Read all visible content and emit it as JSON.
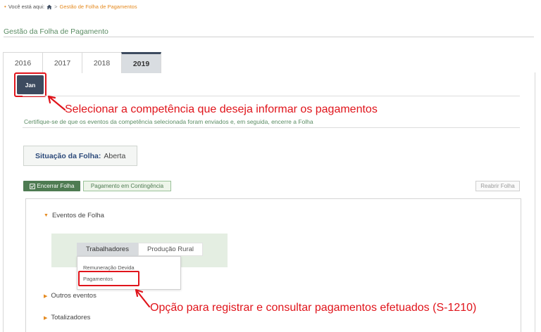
{
  "breadcrumb": {
    "prefix": "Você está aqui:",
    "separator": ">",
    "current": "Gestão de Folha de Pagamentos"
  },
  "page": {
    "title": "Gestão da Folha de Pagamento"
  },
  "year_tabs": [
    {
      "label": "2016",
      "active": false
    },
    {
      "label": "2017",
      "active": false
    },
    {
      "label": "2018",
      "active": false
    },
    {
      "label": "2019",
      "active": true
    }
  ],
  "month": {
    "label": "Jan"
  },
  "annotations": {
    "select_period": "Selecionar a competência que deseja informar os pagamentos",
    "payments_option": "Opção para registrar e consultar pagamentos efetuados (S-1210)"
  },
  "info_text": "Certifique-se de que os eventos da competência selecionada foram enviados e, em seguida, encerre a Folha",
  "status": {
    "label": "Situação da Folha:",
    "value": "Aberta"
  },
  "actions": {
    "close_payroll": "Encerrar Folha",
    "contingency_payment": "Pagamento em Contingência",
    "reopen_payroll": "Reabrir Folha"
  },
  "sections": {
    "payroll_events": "Eventos de Folha",
    "other_events": "Outros eventos",
    "totalizers": "Totalizadores"
  },
  "subtabs": {
    "workers": "Trabalhadores",
    "rural": "Produção Rural"
  },
  "dropdown": {
    "item1": "Remuneração Devida",
    "item2": "Pagamentos"
  },
  "colors": {
    "accent_green": "#4e7b52",
    "navy": "#3d4b5f",
    "annotation_red": "#e0141b",
    "breadcrumb_orange": "#e58a1f"
  }
}
